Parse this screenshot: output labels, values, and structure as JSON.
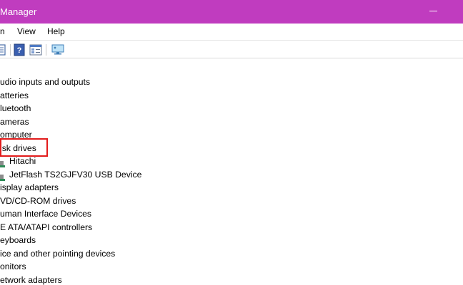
{
  "window": {
    "title": "Manager"
  },
  "menu": [
    {
      "label": "n"
    },
    {
      "label": "View"
    },
    {
      "label": "Help"
    }
  ],
  "toolbar": {
    "buttons": [
      {
        "icon": "properties-icon"
      },
      {
        "icon": "help-icon"
      },
      {
        "icon": "device-view-icon"
      },
      {
        "icon": "scan-hardware-icon"
      }
    ]
  },
  "tree": {
    "items": [
      {
        "label": "udio inputs and outputs"
      },
      {
        "label": "atteries"
      },
      {
        "label": "luetooth"
      },
      {
        "label": "ameras"
      },
      {
        "label": "omputer"
      },
      {
        "label": "isk drives"
      },
      {
        "label": "Hitachi"
      },
      {
        "label": "JetFlash TS2GJFV30 USB Device"
      },
      {
        "label": "isplay adapters"
      },
      {
        "label": "VD/CD-ROM drives"
      },
      {
        "label": "uman Interface Devices"
      },
      {
        "label": "E ATA/ATAPI controllers"
      },
      {
        "label": "eyboards"
      },
      {
        "label": "ice and other pointing devices"
      },
      {
        "label": "onitors"
      },
      {
        "label": "etwork adapters"
      }
    ]
  },
  "colors": {
    "titlebar": "#c03cbf",
    "highlight_border": "#e21b1b"
  }
}
